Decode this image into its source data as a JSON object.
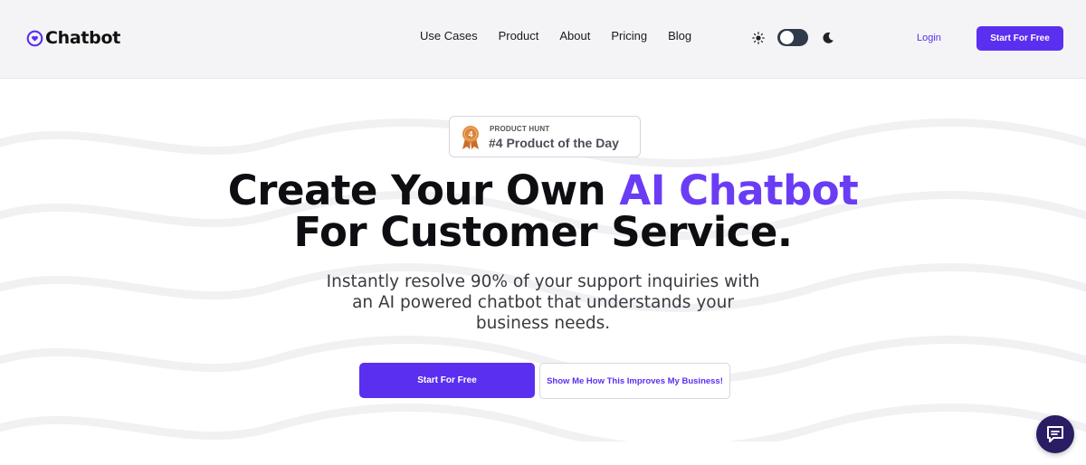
{
  "header": {
    "brand": "Chatbot",
    "nav": [
      "Use Cases",
      "Product",
      "About",
      "Pricing",
      "Blog"
    ],
    "theme_toggle": {
      "mode": "dark"
    },
    "login_label": "Login",
    "cta_label": "Start For Free"
  },
  "hero": {
    "badge": {
      "kicker": "PRODUCT HUNT",
      "title": "#4 Product of the Day",
      "rank": "4"
    },
    "headline_part1": "Create Your Own ",
    "headline_accent": "AI Chatbot",
    "headline_line2": "For Customer Service.",
    "subtitle": "Instantly resolve 90% of your support inquiries with an AI powered chatbot that understands your business needs.",
    "primary_cta": "Start For Free",
    "secondary_cta": "Show Me How This Improves My Business!"
  },
  "colors": {
    "accent": "#5b2ff0",
    "headline_accent": "#6a3df5",
    "fab": "#2a1d63",
    "medal": "#d9853b"
  },
  "icons": {
    "logo": "chat-bubble-heart-icon",
    "sun": "sun-icon",
    "moon": "moon-icon",
    "medal": "medal-icon",
    "chat": "chat-icon"
  }
}
